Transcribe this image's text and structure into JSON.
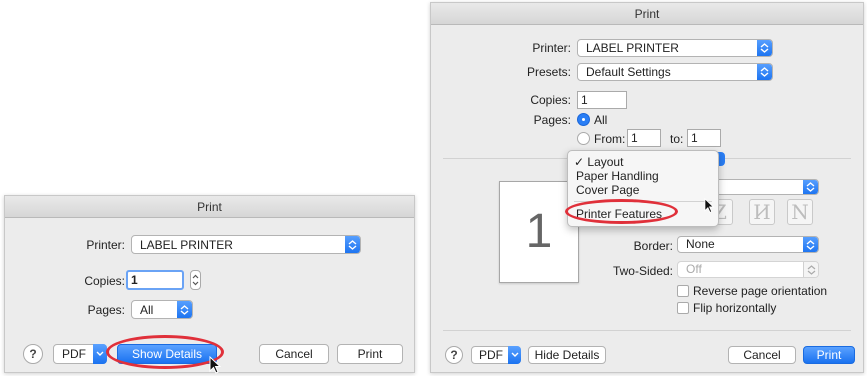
{
  "left_dialog": {
    "title": "Print",
    "printer_label": "Printer:",
    "printer_value": "LABEL PRINTER",
    "copies_label": "Copies:",
    "copies_value": "1",
    "pages_label": "Pages:",
    "pages_value": "All",
    "help_symbol": "?",
    "pdf_label": "PDF",
    "show_details_label": "Show Details",
    "cancel_label": "Cancel",
    "print_label": "Print"
  },
  "right_dialog": {
    "title": "Print",
    "printer_label": "Printer:",
    "printer_value": "LABEL PRINTER",
    "presets_label": "Presets:",
    "presets_value": "Default Settings",
    "copies_label": "Copies:",
    "copies_value": "1",
    "pages_label": "Pages:",
    "pages_all_label": "All",
    "pages_from_label": "From:",
    "pages_from_value": "1",
    "pages_to_label": "to:",
    "pages_to_value": "1",
    "preview_page_number": "1",
    "menu": {
      "checked_mark": "✓",
      "items": [
        "Layout",
        "Paper Handling",
        "Cover Page"
      ],
      "highlighted": "Printer Features"
    },
    "layout_direction_glyphs": [
      "Z",
      "И",
      "N"
    ],
    "border_label": "Border:",
    "border_value": "None",
    "two_sided_label": "Two-Sided:",
    "two_sided_value": "Off",
    "reverse_orientation_label": "Reverse page orientation",
    "flip_horizontal_label": "Flip horizontally",
    "help_symbol": "?",
    "pdf_label": "PDF",
    "hide_details_label": "Hide Details",
    "cancel_label": "Cancel",
    "print_label": "Print"
  },
  "colors": {
    "accent_blue": "#1a72f0",
    "annotation_red": "#e0303a",
    "dialog_background": "#ececec"
  }
}
